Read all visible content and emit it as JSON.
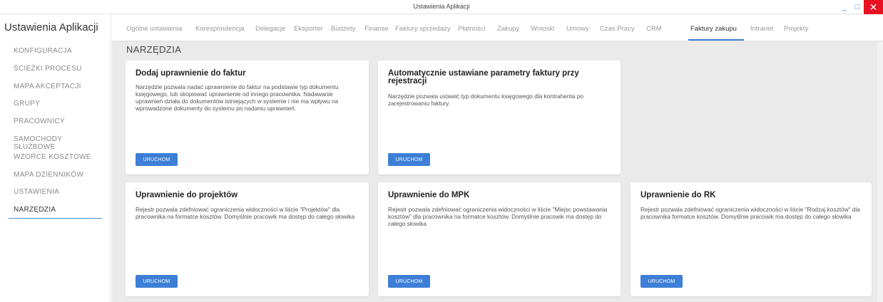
{
  "window": {
    "title": "Ustawienia Aplikacji",
    "minimize_glyph": "_",
    "maximize_glyph": "□",
    "close_glyph": "✕"
  },
  "sidebar": {
    "title": "Ustawienia Aplikacji",
    "items": [
      {
        "label": "KONFIGURACJA"
      },
      {
        "label": "ŚCIEŻKI PROCESU"
      },
      {
        "label": "MAPA AKCEPTACJI"
      },
      {
        "label": "GRUPY"
      },
      {
        "label": "PRACOWNICY"
      },
      {
        "label": "SAMOCHODY SŁUŻBOWE"
      },
      {
        "label": "WZORCE KOSZTOWE"
      },
      {
        "label": "MAPA DZIENNIKÓW"
      },
      {
        "label": "USTAWIENIA"
      },
      {
        "label": "NARZĘDZIA",
        "active": true
      }
    ]
  },
  "tabs": [
    {
      "label": "Ogólne ustawienia"
    },
    {
      "label": "Korespondencja"
    },
    {
      "label": "Delegacje"
    },
    {
      "label": "Eksporter"
    },
    {
      "label": "Budżety"
    },
    {
      "label": "Finanse"
    },
    {
      "label": "Faktury sprzedaży"
    },
    {
      "label": "Płatności"
    },
    {
      "label": "Zakupy"
    },
    {
      "label": "Wnioski"
    },
    {
      "label": "Umowy"
    },
    {
      "label": "Czas Pracy"
    },
    {
      "label": "CRM"
    },
    {
      "label": "Faktury zakupu",
      "active": true
    },
    {
      "label": "Intranet"
    },
    {
      "label": "Projekty"
    }
  ],
  "section_title": "NARZĘDZIA",
  "cards": [
    {
      "title": "Dodaj uprawnienie do faktur",
      "description": "Narzędzie pozwala nadać uprawnienie do faktur na podstawie typ dokumentu księgowego, lub skopiować uprawnienie od innego pracownika. Nadawanie uprawnień działa do dokumentów istniejących w systemie i nie ma wpływu na wprowadzone dokumenty do systemu po nadaniu uprawnień.",
      "button": "URUCHOM"
    },
    {
      "title": "Automatycznie ustawiane parametry faktury przy rejestracji",
      "description": "Narzędzie pozwala ustawić typ dokumentu księgowego dla kontrahenta po zarejestrowaniu faktury.",
      "button": "URUCHOM"
    },
    {
      "title": "Uprawnienie do projektów",
      "description": "Rejestr pozwala zdefniować ograniczenia widoczności w liście \"Projektów\" dla pracownika na formatce kosztów. Domyślnie pracowik ma dostęp do całego słowika",
      "button": "URUCHOM"
    },
    {
      "title": "Uprawnienie do MPK",
      "description": "Rejestr pozwala zdefniować ograniczenia widoczności w liście \"Miejsc powstawania kosztów\" dla pracownika na formatce kosztów. Domyślnie pracowik ma dostęp do całego słowika",
      "button": "URUCHOM"
    },
    {
      "title": "Uprawnienie do RK",
      "description": "Rejestr pozwala zdefniować ograniczenia widoczności w liście \"Rodzaj kosztów\" dla pracownika formatce kosztów. Domyślnie pracowik ma dostęp do całego słowika",
      "button": "URUCHOM"
    }
  ],
  "colors": {
    "accent": "#3d7fd6",
    "close": "#e81123",
    "content_bg": "#eaeaea"
  }
}
